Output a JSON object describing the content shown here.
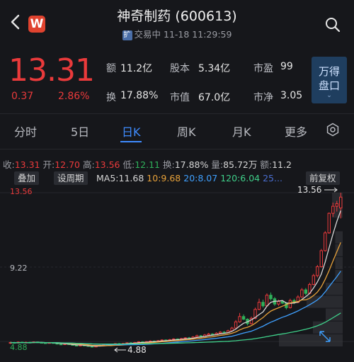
{
  "header": {
    "title": "神奇制药 (600613)",
    "status_tag": "扩",
    "status_text": "交易中 11-18 11:29:59",
    "logo_letter": "W"
  },
  "quote": {
    "price": "13.31",
    "change": "0.37",
    "change_pct": "2.86%",
    "stats": [
      {
        "label": "额",
        "value": "11.2亿"
      },
      {
        "label": "股本",
        "value": "5.34亿"
      },
      {
        "label": "市盈",
        "value": "99"
      },
      {
        "label": "换",
        "value": "17.88%"
      },
      {
        "label": "市值",
        "value": "67.0亿"
      },
      {
        "label": "市净",
        "value": "3.05"
      }
    ],
    "wande_line1": "万得",
    "wande_line2": "盘口",
    "wande_chevron": "⌄"
  },
  "tabs": [
    "分时",
    "5日",
    "日K",
    "周K",
    "月K",
    "更多"
  ],
  "info_row": {
    "close_label": "收:",
    "close": "13.31",
    "open_label": "开:",
    "open": "12.70",
    "high_label": "高:",
    "high": "13.56",
    "low_label": "低:",
    "low": "12.11",
    "turnover_label": "换:",
    "turnover": "17.88%",
    "volume_label": "量:",
    "volume": "85.72万",
    "amount_label": "额:",
    "amount": "11.2"
  },
  "toolbar": {
    "overlay": "叠加",
    "set_period": "设周期",
    "ma5_label": "MA5:",
    "ma5": "11.68",
    "ma10_label": "10:",
    "ma10": "9.68",
    "ma20_label": "20:",
    "ma20": "8.07",
    "ma120_label": "120:",
    "ma120": "6.04",
    "ma250_label": "25...",
    "adjust": "前复权"
  },
  "chart_labels": {
    "y_top": "13.56",
    "y_mid": "9.22",
    "y_bottom": "4.88",
    "high_marker": "13.56",
    "low_marker": "4.88"
  },
  "chart_data": {
    "type": "candlestick",
    "ylim": [
      4.88,
      13.56
    ],
    "y_ticks": [
      13.56,
      9.22,
      4.88
    ],
    "high": 13.56,
    "low": 4.88,
    "candles": [
      [
        5.1,
        5.14,
        5.05,
        5.18
      ],
      [
        5.14,
        5.11,
        5.08,
        5.17
      ],
      [
        5.11,
        5.16,
        5.09,
        5.2
      ],
      [
        5.16,
        5.12,
        5.1,
        5.18
      ],
      [
        5.12,
        5.15,
        5.1,
        5.19
      ],
      [
        5.15,
        5.13,
        5.11,
        5.18
      ],
      [
        5.13,
        5.17,
        5.11,
        5.2
      ],
      [
        5.17,
        5.14,
        5.12,
        5.19
      ],
      [
        5.14,
        5.12,
        5.1,
        5.17
      ],
      [
        5.12,
        5.1,
        5.08,
        5.15
      ],
      [
        5.1,
        5.13,
        5.08,
        5.16
      ],
      [
        5.13,
        5.11,
        5.09,
        5.15
      ],
      [
        5.11,
        5.05,
        5.03,
        5.13
      ],
      [
        5.05,
        5.02,
        5.0,
        5.08
      ],
      [
        5.02,
        5.06,
        5.0,
        5.09
      ],
      [
        5.06,
        5.03,
        5.01,
        5.08
      ],
      [
        5.03,
        4.98,
        4.96,
        5.05
      ],
      [
        4.98,
        4.95,
        4.93,
        5.01
      ],
      [
        4.95,
        4.99,
        4.93,
        5.02
      ],
      [
        4.99,
        4.96,
        4.94,
        5.02
      ],
      [
        4.96,
        4.92,
        4.9,
        4.98
      ],
      [
        4.92,
        4.89,
        4.88,
        4.95
      ],
      [
        4.89,
        4.94,
        4.88,
        4.97
      ],
      [
        4.94,
        4.98,
        4.92,
        5.01
      ],
      [
        4.98,
        5.02,
        4.96,
        5.05
      ],
      [
        5.02,
        5.0,
        4.98,
        5.06
      ],
      [
        5.0,
        5.04,
        4.98,
        5.07
      ],
      [
        5.04,
        5.08,
        5.02,
        5.11
      ],
      [
        5.08,
        5.05,
        5.03,
        5.11
      ],
      [
        5.05,
        5.09,
        5.03,
        5.12
      ],
      [
        5.09,
        5.12,
        5.07,
        5.15
      ],
      [
        5.12,
        5.1,
        5.08,
        5.16
      ],
      [
        5.1,
        5.14,
        5.08,
        5.17
      ],
      [
        5.14,
        5.18,
        5.12,
        5.21
      ],
      [
        5.18,
        5.15,
        5.13,
        5.21
      ],
      [
        5.15,
        5.19,
        5.13,
        5.22
      ],
      [
        5.19,
        5.22,
        5.17,
        5.26
      ],
      [
        5.22,
        5.2,
        5.18,
        5.25
      ],
      [
        5.2,
        5.24,
        5.18,
        5.28
      ],
      [
        5.24,
        5.28,
        5.22,
        5.32
      ],
      [
        5.28,
        5.25,
        5.23,
        5.31
      ],
      [
        5.25,
        5.3,
        5.23,
        5.34
      ],
      [
        5.3,
        5.34,
        5.28,
        5.38
      ],
      [
        5.34,
        5.31,
        5.29,
        5.37
      ],
      [
        5.31,
        5.36,
        5.29,
        5.4
      ],
      [
        5.36,
        5.4,
        5.34,
        5.44
      ],
      [
        5.4,
        5.38,
        5.35,
        5.45
      ],
      [
        5.38,
        5.45,
        5.36,
        5.5
      ],
      [
        5.45,
        5.52,
        5.43,
        5.58
      ],
      [
        5.52,
        5.48,
        5.45,
        5.56
      ],
      [
        5.48,
        5.56,
        5.46,
        5.62
      ],
      [
        5.56,
        5.62,
        5.53,
        5.68
      ],
      [
        5.62,
        5.58,
        5.55,
        5.66
      ],
      [
        5.58,
        5.66,
        5.56,
        5.72
      ],
      [
        5.66,
        5.72,
        5.63,
        5.78
      ],
      [
        5.72,
        5.7,
        5.66,
        5.78
      ],
      [
        5.7,
        5.8,
        5.68,
        5.86
      ],
      [
        5.8,
        5.95,
        5.78,
        6.02
      ],
      [
        5.95,
        6.3,
        5.93,
        6.4
      ],
      [
        6.3,
        6.6,
        6.25,
        6.8
      ],
      [
        6.6,
        6.45,
        6.4,
        6.72
      ],
      [
        6.45,
        6.2,
        6.1,
        6.5
      ],
      [
        6.2,
        6.5,
        6.15,
        6.6
      ],
      [
        6.5,
        7.0,
        6.45,
        7.1
      ],
      [
        7.0,
        7.4,
        6.95,
        7.6
      ],
      [
        7.4,
        7.2,
        7.1,
        7.55
      ],
      [
        7.2,
        7.8,
        7.15,
        7.9
      ],
      [
        7.8,
        7.6,
        7.5,
        7.95
      ],
      [
        7.6,
        7.3,
        7.2,
        7.7
      ],
      [
        7.3,
        7.45,
        7.2,
        7.55
      ],
      [
        7.45,
        7.35,
        7.3,
        7.5
      ],
      [
        7.35,
        7.1,
        7.0,
        7.4
      ],
      [
        7.1,
        7.5,
        7.05,
        7.6
      ],
      [
        7.5,
        7.4,
        7.3,
        7.6
      ],
      [
        7.4,
        7.7,
        7.35,
        7.8
      ],
      [
        7.7,
        8.1,
        7.65,
        8.2
      ],
      [
        8.1,
        7.9,
        7.8,
        8.2
      ],
      [
        7.9,
        8.4,
        7.85,
        8.5
      ],
      [
        8.4,
        8.9,
        8.35,
        9.0
      ],
      [
        8.9,
        9.4,
        8.8,
        9.5
      ],
      [
        9.4,
        10.3,
        9.35,
        10.4
      ],
      [
        10.3,
        11.3,
        10.25,
        11.4
      ],
      [
        11.3,
        12.4,
        11.25,
        12.45
      ],
      [
        12.4,
        12.8,
        12.2,
        13.0
      ],
      [
        12.8,
        12.94,
        12.5,
        13.1
      ],
      [
        12.7,
        13.31,
        12.11,
        13.56
      ]
    ]
  }
}
